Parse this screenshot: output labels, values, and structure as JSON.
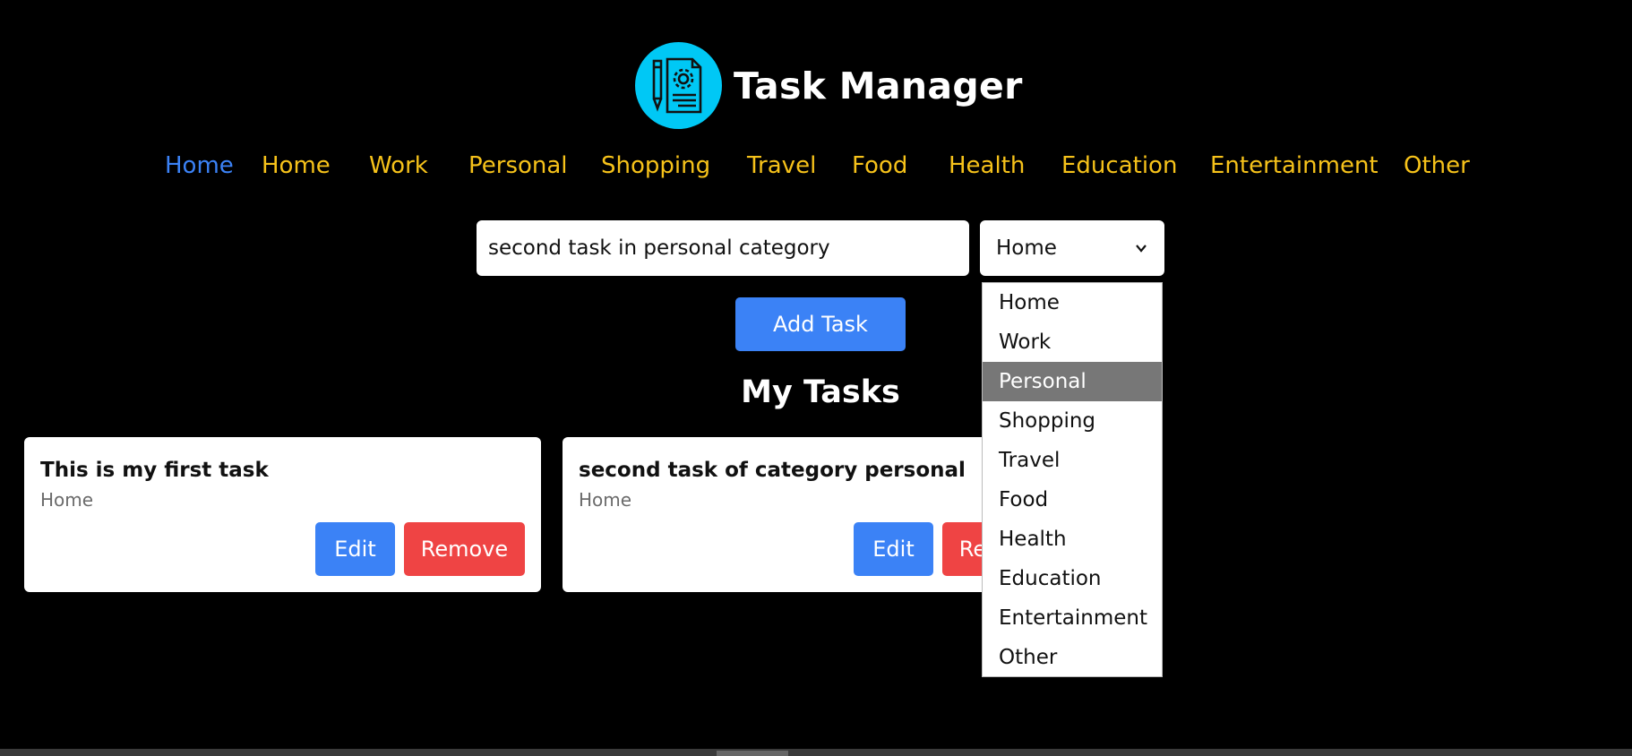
{
  "app": {
    "title": "Task Manager",
    "logo_icon": "task-document-gear-icon"
  },
  "nav": {
    "items": [
      {
        "label": "Home",
        "active": true
      },
      {
        "label": "Home",
        "active": false
      },
      {
        "label": "Work",
        "active": false
      },
      {
        "label": "Personal",
        "active": false
      },
      {
        "label": "Shopping",
        "active": false
      },
      {
        "label": "Travel",
        "active": false
      },
      {
        "label": "Food",
        "active": false
      },
      {
        "label": "Health",
        "active": false
      },
      {
        "label": "Education",
        "active": false
      },
      {
        "label": "Entertainment",
        "active": false
      },
      {
        "label": "Other",
        "active": false
      }
    ]
  },
  "form": {
    "task_value": "second task in personal category",
    "selected_category": "Home",
    "add_label": "Add Task"
  },
  "dropdown": {
    "options": [
      "Home",
      "Work",
      "Personal",
      "Shopping",
      "Travel",
      "Food",
      "Health",
      "Education",
      "Entertainment",
      "Other"
    ],
    "highlighted": "Personal"
  },
  "tasks": {
    "heading": "My Tasks",
    "items": [
      {
        "title": "This is my first task",
        "category": "Home",
        "edit_label": "Edit",
        "remove_label": "Remove"
      },
      {
        "title": "second task of category personal",
        "category": "Home",
        "edit_label": "Edit",
        "remove_label": "Remove"
      }
    ]
  },
  "colors": {
    "background": "#000000",
    "accent_blue": "#3b82f6",
    "nav_yellow": "#f6c21a",
    "remove_red": "#ef4444",
    "logo_cyan": "#00c8f5"
  }
}
